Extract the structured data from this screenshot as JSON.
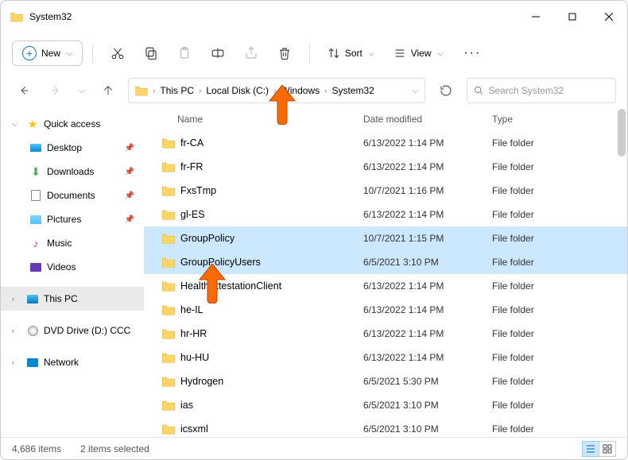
{
  "window": {
    "title": "System32"
  },
  "toolbar": {
    "new_label": "New",
    "sort_label": "Sort",
    "view_label": "View"
  },
  "breadcrumb": {
    "items": [
      "This PC",
      "Local Disk (C:)",
      "Windows",
      "System32"
    ]
  },
  "search": {
    "placeholder": "Search System32"
  },
  "sidebar": {
    "quick_access": "Quick access",
    "desktop": "Desktop",
    "downloads": "Downloads",
    "documents": "Documents",
    "pictures": "Pictures",
    "music": "Music",
    "videos": "Videos",
    "this_pc": "This PC",
    "dvd": "DVD Drive (D:) CCCC",
    "network": "Network"
  },
  "columns": {
    "name": "Name",
    "date": "Date modified",
    "type": "Type"
  },
  "rows": [
    {
      "name": "fr-CA",
      "date": "6/13/2022 1:14 PM",
      "type": "File folder",
      "selected": false
    },
    {
      "name": "fr-FR",
      "date": "6/13/2022 1:14 PM",
      "type": "File folder",
      "selected": false
    },
    {
      "name": "FxsTmp",
      "date": "10/7/2021 1:16 PM",
      "type": "File folder",
      "selected": false
    },
    {
      "name": "gl-ES",
      "date": "6/13/2022 1:14 PM",
      "type": "File folder",
      "selected": false
    },
    {
      "name": "GroupPolicy",
      "date": "10/7/2021 1:15 PM",
      "type": "File folder",
      "selected": true
    },
    {
      "name": "GroupPolicyUsers",
      "date": "6/5/2021 3:10 PM",
      "type": "File folder",
      "selected": true
    },
    {
      "name": "HealthAttestationClient",
      "date": "6/13/2022 1:14 PM",
      "type": "File folder",
      "selected": false
    },
    {
      "name": "he-IL",
      "date": "6/13/2022 1:14 PM",
      "type": "File folder",
      "selected": false
    },
    {
      "name": "hr-HR",
      "date": "6/13/2022 1:14 PM",
      "type": "File folder",
      "selected": false
    },
    {
      "name": "hu-HU",
      "date": "6/13/2022 1:14 PM",
      "type": "File folder",
      "selected": false
    },
    {
      "name": "Hydrogen",
      "date": "6/5/2021 5:30 PM",
      "type": "File folder",
      "selected": false
    },
    {
      "name": "ias",
      "date": "6/5/2021 3:10 PM",
      "type": "File folder",
      "selected": false
    },
    {
      "name": "icsxml",
      "date": "6/5/2021 3:10 PM",
      "type": "File folder",
      "selected": false
    }
  ],
  "status": {
    "count": "4,686 items",
    "selection": "2 items selected"
  }
}
